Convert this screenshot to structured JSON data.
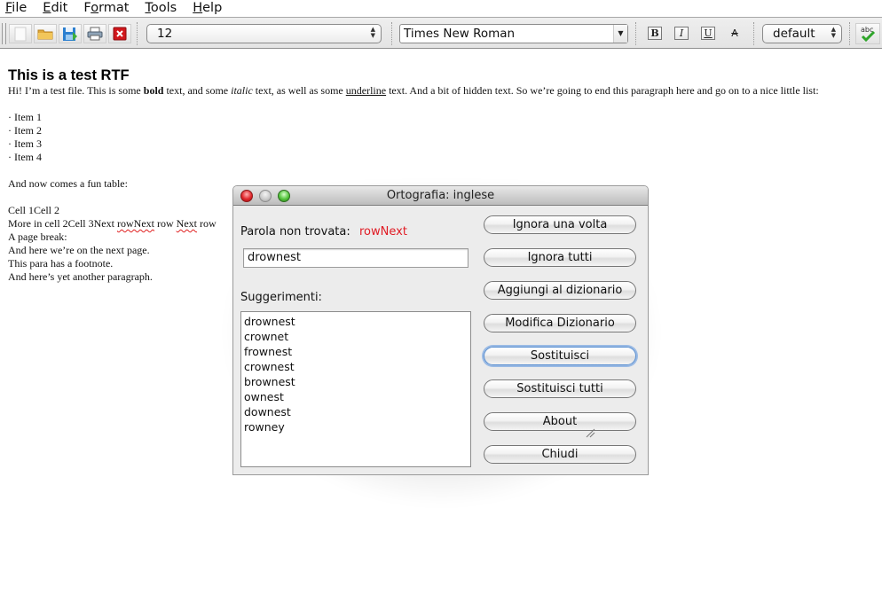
{
  "menubar": {
    "items": [
      {
        "label": "File",
        "mnemonic": "F",
        "rest": "ile"
      },
      {
        "label": "Edit",
        "mnemonic": "E",
        "rest": "dit"
      },
      {
        "label": "Format",
        "pre": "F",
        "mnemonic": "o",
        "rest": "rmat"
      },
      {
        "label": "Tools",
        "mnemonic": "T",
        "rest": "ools"
      },
      {
        "label": "Help",
        "mnemonic": "H",
        "rest": "elp"
      }
    ]
  },
  "toolbar": {
    "buttons": [
      {
        "name": "new-document",
        "icon": "blank-page-icon"
      },
      {
        "name": "open",
        "icon": "folder-icon"
      },
      {
        "name": "save",
        "icon": "floppy-disk-icon"
      },
      {
        "name": "print",
        "icon": "printer-icon"
      },
      {
        "name": "close",
        "icon": "red-x-icon"
      }
    ],
    "font_size": "12",
    "font_family": "Times New Roman",
    "format_buttons": {
      "bold": "B",
      "italic": "I",
      "underline": "U",
      "strike": "A"
    },
    "style": "default",
    "spellcheck_label": "abc"
  },
  "document": {
    "title": "This is a test RTF",
    "intro": {
      "p1": "Hi! I’m a test file. This is some ",
      "bold": "bold",
      "p2": " text, and some ",
      "italic": "italic",
      "p3": " text, as well as some ",
      "underline": "underline",
      "p4": " text. And a bit of hidden text. So we’re going to end this paragraph here and go on to a nice little list:"
    },
    "list": [
      "· Item 1",
      "· Item 2",
      "· Item 3",
      "· Item 4"
    ],
    "table_intro": "And now comes a fun table:",
    "cells_line1": "Cell 1Cell 2",
    "cells_line2": {
      "a": "More in cell 2Cell 3Next ",
      "misspelled1": "rowNext",
      "b": " row ",
      "misspelled2": "Next",
      "c": " row"
    },
    "lines_after": [
      "A page break:",
      "And here we’re on the next page.",
      "This para has a footnote.",
      "And here’s yet another paragraph."
    ]
  },
  "dialog": {
    "title": "Ortografia: inglese",
    "not_found_label": "Parola non trovata:",
    "not_found_word": "rowNext",
    "replacement_value": "drownest",
    "suggestions_label": "Suggerimenti:",
    "suggestions": [
      "drownest",
      "crownet",
      "frownest",
      "crownest",
      "brownest",
      "ownest",
      "downest",
      "rowney"
    ],
    "buttons": [
      {
        "label": "Ignora una volta"
      },
      {
        "label": "Ignora tutti"
      },
      {
        "label": "Aggiungi al dizionario"
      },
      {
        "label": "Modifica Dizionario"
      },
      {
        "label": "Sostituisci",
        "focused": true
      },
      {
        "label": "Sostituisci tutti"
      },
      {
        "label": "About"
      },
      {
        "label": "Chiudi"
      }
    ]
  }
}
